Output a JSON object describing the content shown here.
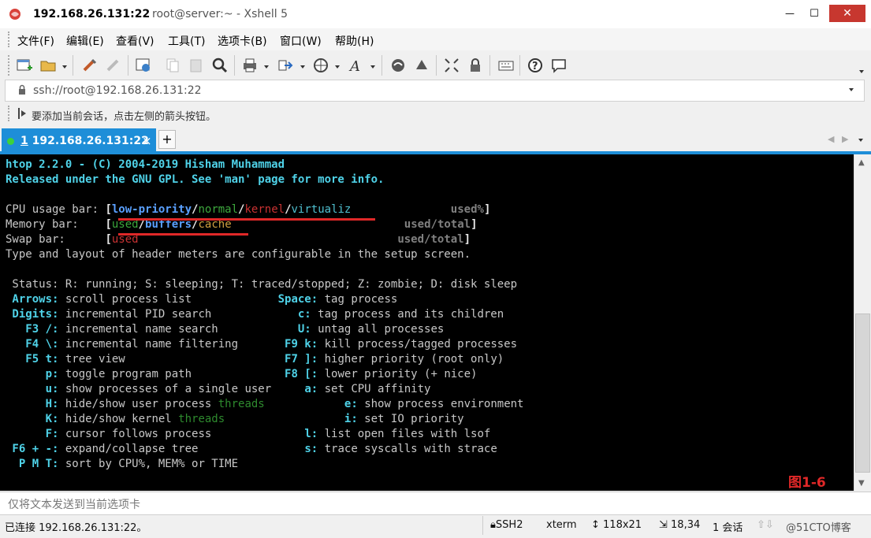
{
  "window": {
    "host_title": "192.168.26.131:22",
    "title_rest": "root@server:~ - Xshell 5",
    "close_glyph": "✕",
    "minimize_glyph": "—",
    "maximize_glyph": "☐"
  },
  "menu": [
    "文件(F)",
    "编辑(E)",
    "查看(V)",
    "工具(T)",
    "选项卡(B)",
    "窗口(W)",
    "帮助(H)"
  ],
  "address": {
    "value": "ssh://root@192.168.26.131:22"
  },
  "hint": "要添加当前会话，点击左侧的箭头按钮。",
  "tab": {
    "number": "1",
    "label": "192.168.26.131:22",
    "close": "×",
    "add": "+"
  },
  "terminal": {
    "l1": "htop 2.2.0 - (C) 2004-2019 Hisham Muhammad",
    "l2": "Released under the GNU GPL. See 'man' page for more info.",
    "cpu": {
      "label": "CPU usage bar: ",
      "open": "[",
      "low": "low-priority",
      "slash": "/",
      "normal": "normal",
      "kernel": "kernel",
      "virt": "virtualiz",
      "used": "used%",
      "close": "]"
    },
    "mem": {
      "label": "Memory bar:    ",
      "used": "used",
      "buffers": "buffers",
      "cache": "cache",
      "total": "used/total"
    },
    "swap": {
      "label": "Swap bar:      ",
      "used": "used",
      "total": "used/total"
    },
    "l6": "Type and layout of header meters are configurable in the setup screen.",
    "status": " Status: R: running; S: sleeping; T: traced/stopped; Z: zombie; D: disk sleep",
    "keys": [
      {
        "k1": " Arrows:",
        "d1": " scroll process list             ",
        "k2": "Space:",
        "d2": " tag process"
      },
      {
        "k1": " Digits:",
        "d1": " incremental PID search             ",
        "k2": "c:",
        "d2": " tag process and its children"
      },
      {
        "k1": "   F3 /:",
        "d1": " incremental name search            ",
        "k2": "U:",
        "d2": " untag all processes"
      },
      {
        "k1": "   F4 \\:",
        "d1": " incremental name filtering       ",
        "k2": "F9 k:",
        "d2": " kill process/tagged processes"
      },
      {
        "k1": "   F5 t:",
        "d1": " tree view                        ",
        "k2": "F7 ]:",
        "d2": " higher priority (root only)"
      },
      {
        "k1": "      p:",
        "d1": " toggle program path              ",
        "k2": "F8 [:",
        "d2": " lower priority (+ nice)"
      },
      {
        "k1": "      u:",
        "d1": " show processes of a single user     ",
        "k2": "a:",
        "d2": " set CPU affinity"
      },
      {
        "k1": "      H:",
        "d1": " hide/show user process ",
        "t": "threads",
        "pad": "            ",
        "k2": "e:",
        "d2": " show process environment"
      },
      {
        "k1": "      K:",
        "d1": " hide/show kernel ",
        "t": "threads",
        "pad": "                  ",
        "k2": "i:",
        "d2": " set IO priority"
      },
      {
        "k1": "      F:",
        "d1": " cursor follows process              ",
        "k2": "l:",
        "d2": " list open files with lsof"
      },
      {
        "k1": " F6 + -:",
        "d1": " expand/collapse tree                ",
        "k2": "s:",
        "d2": " trace syscalls with strace"
      },
      {
        "k1": "  P M T:",
        "d1": " sort by CPU%, MEM% or TIME",
        "k2": "",
        "d2": ""
      }
    ],
    "figure_label": "图1-6"
  },
  "sendbar": "仅将文本发送到当前选项卡",
  "status": {
    "connected": "已连接 192.168.26.131:22。",
    "protocol": "SSH2",
    "term": "xterm",
    "size": "118x21",
    "cursor": "18,34",
    "sessions": "1 会话",
    "watermark": "@51CTO博客"
  },
  "colors": {
    "accent": "#1e8ed8",
    "close": "#c7372f",
    "terminal_bg": "#000000",
    "highlight": "#e02828"
  }
}
